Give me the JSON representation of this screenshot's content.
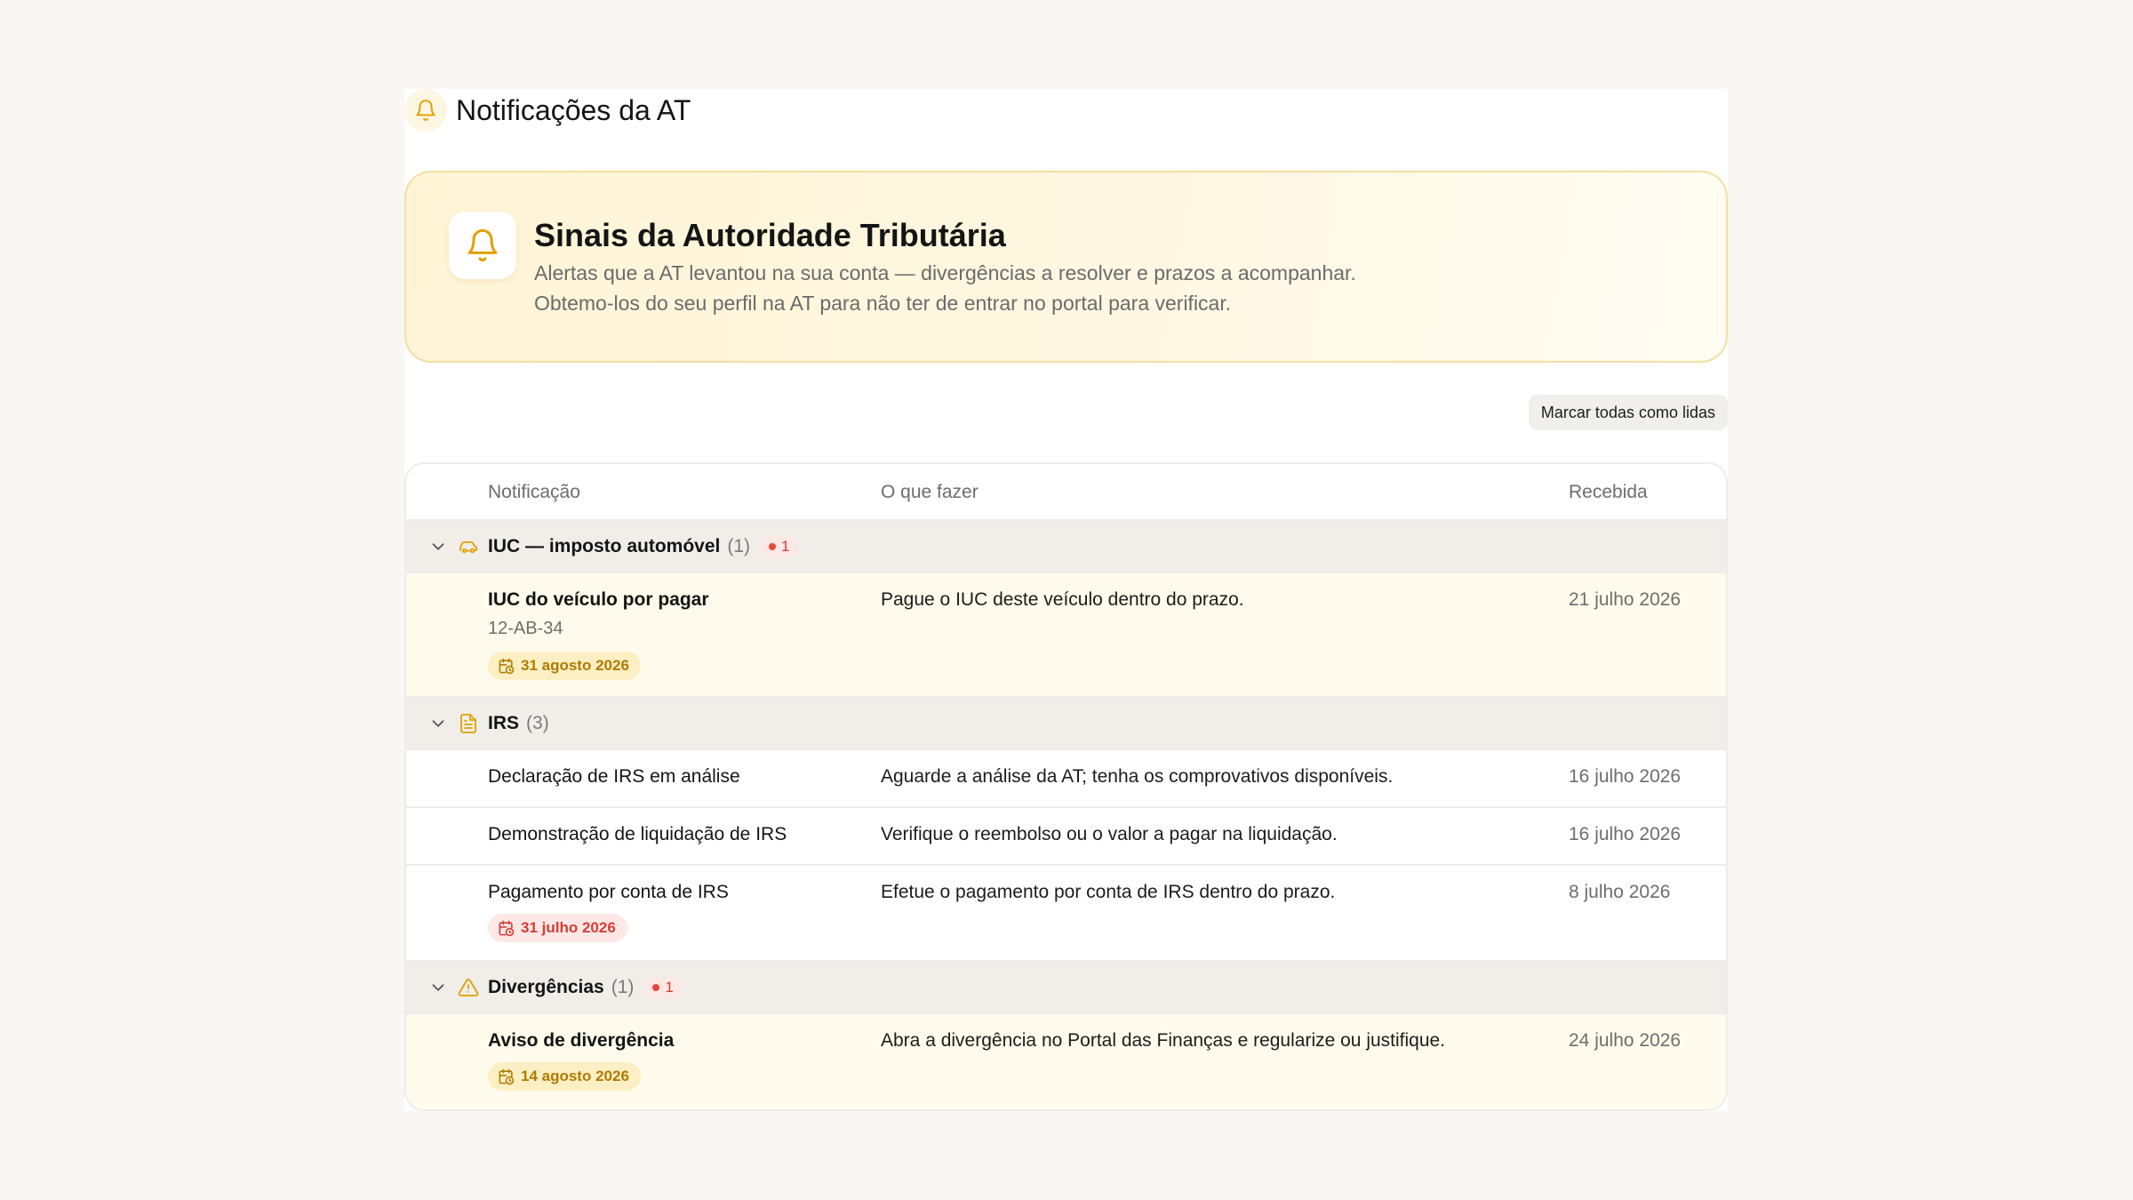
{
  "header": {
    "title": "Notificações da AT",
    "icon": "bell-icon"
  },
  "hero": {
    "title": "Sinais da Autoridade Tributária",
    "line1": "Alertas que a AT levantou na sua conta — divergências a resolver e prazos a acompanhar.",
    "line2": "Obtemo-los do seu perfil na AT para não ter de entrar no portal para verificar.",
    "icon": "bell-icon"
  },
  "actions": {
    "mark_all_read": "Marcar todas como lidas"
  },
  "table": {
    "columns": {
      "notification": "Notificação",
      "todo": "O que fazer",
      "received": "Recebida"
    },
    "groups": [
      {
        "label": "IUC — imposto automóvel",
        "count": "(1)",
        "badge": "1",
        "icon": "car-icon",
        "rows": [
          {
            "title": "IUC do veículo por pagar",
            "sub": "12-AB-34",
            "deadline": "31 agosto 2026",
            "action": "Pague o IUC deste veículo dentro do prazo.",
            "date": "21 julho 2026"
          }
        ]
      },
      {
        "label": "IRS",
        "count": "(3)",
        "icon": "document-icon",
        "rows": [
          {
            "title": "Declaração de IRS em análise",
            "action": "Aguarde a análise da AT; tenha os comprovativos disponíveis.",
            "date": "16 julho 2026"
          },
          {
            "title": "Demonstração de liquidação de IRS",
            "action": "Verifique o reembolso ou o valor a pagar na liquidação.",
            "date": "16 julho 2026"
          },
          {
            "title": "Pagamento por conta de IRS",
            "deadline": "31 julho 2026",
            "action": "Efetue o pagamento por conta de IRS dentro do prazo.",
            "date": "8 julho 2026"
          }
        ]
      },
      {
        "label": "Divergências",
        "count": "(1)",
        "badge": "1",
        "icon": "warning-icon",
        "rows": [
          {
            "title": "Aviso de divergência",
            "deadline": "14 agosto 2026",
            "action": "Abra a divergência no Portal das Finanças e regularize ou justifique.",
            "date": "24 julho 2026"
          }
        ]
      }
    ]
  },
  "colors": {
    "accent": "#e0a100",
    "alert": "#e5483f",
    "highlight_row": "#fffbec"
  }
}
